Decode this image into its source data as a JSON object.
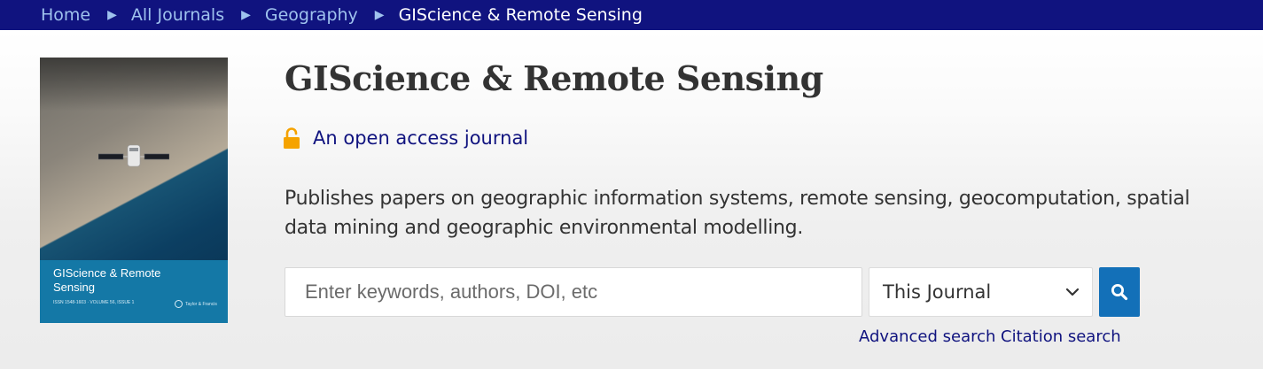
{
  "breadcrumb": {
    "items": [
      {
        "label": "Home"
      },
      {
        "label": "All Journals"
      },
      {
        "label": "Geography"
      },
      {
        "label": "GIScience & Remote Sensing"
      }
    ],
    "separator": "▶"
  },
  "cover": {
    "title": "GIScience & Remote Sensing",
    "issn_lines": "ISSN 1548-1603 · VOLUME 56, ISSUE 1",
    "publisher": "Taylor & Francis"
  },
  "journal": {
    "title": "GIScience & Remote Sensing",
    "open_access_label": "An open access journal",
    "description": "Publishes papers on geographic information systems, remote sensing, geocomputation, spatial data mining and geographic environmental modelling."
  },
  "search": {
    "placeholder": "Enter keywords, authors, DOI, etc",
    "value": "",
    "scope_selected": "This Journal",
    "advanced_label": "Advanced search",
    "citation_label": "Citation search"
  },
  "icons": {
    "separator": "triangle-right-icon",
    "open_access": "unlocked-padlock-icon",
    "dropdown": "chevron-down-icon",
    "search": "magnifier-icon"
  },
  "colors": {
    "breadcrumb_bg": "#10137f",
    "breadcrumb_link": "#9fc2ee",
    "accent_blue": "#1370b8",
    "link_navy": "#10137f",
    "lock_orange": "#f5a300",
    "cover_panel": "#1478a6"
  }
}
